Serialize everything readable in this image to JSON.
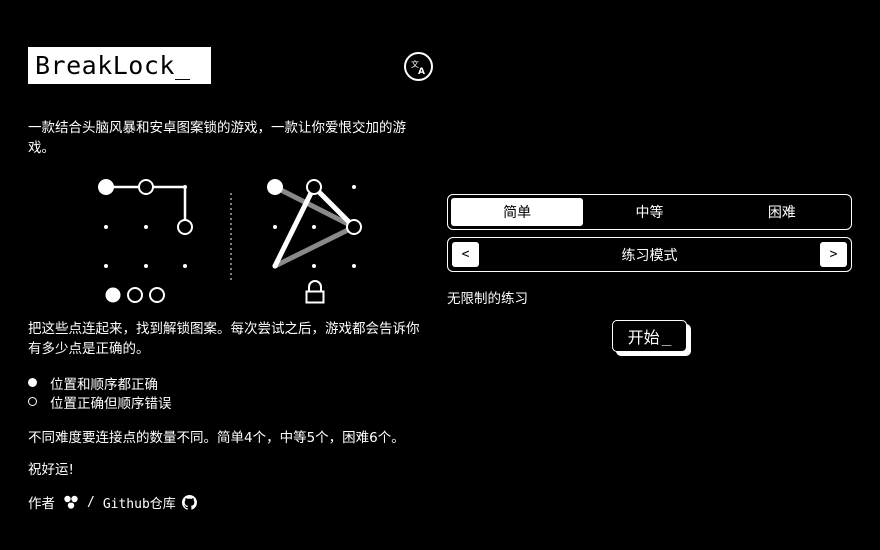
{
  "app": {
    "logo_text": "BreakLock_"
  },
  "header": {
    "lang_icon": "translate-icon"
  },
  "intro": {
    "text": "一款结合头脑风暴和安卓图案锁的游戏，一款让你爱恨交加的游戏。"
  },
  "demo": {
    "left_icon": "pattern-attempt-icon",
    "right_icon": "pattern-solution-icon",
    "lock_icon": "lock-icon",
    "result_correct": 1,
    "result_misplaced": 2
  },
  "instructions": {
    "text": "把这些点连起来，找到解锁图案。每次尝试之后，游戏都会告诉你有多少点是正确的。",
    "legend": [
      {
        "label": "位置和顺序都正确",
        "marker": "filled"
      },
      {
        "label": "位置正确但顺序错误",
        "marker": "hollow"
      }
    ],
    "difficulty_note": "不同难度要连接点的数量不同。简单4个，中等5个，困难6个。",
    "good_luck": "祝好运!"
  },
  "footer": {
    "author_label": "作者",
    "author_icon": "author-logo-icon",
    "separator": "/",
    "github_label": "Github仓库",
    "github_icon": "github-icon"
  },
  "game": {
    "difficulty_tabs": [
      {
        "label": "简单",
        "active": true
      },
      {
        "label": "中等",
        "active": false
      },
      {
        "label": "困难",
        "active": false
      }
    ],
    "mode": {
      "prev_label": "<",
      "label": "练习模式",
      "next_label": ">",
      "description": "无限制的练习"
    },
    "start_label": "开始",
    "start_caret": "_"
  },
  "colors": {
    "background": "#000000",
    "foreground": "#ffffff",
    "faded_line": "#8a8a8a"
  }
}
